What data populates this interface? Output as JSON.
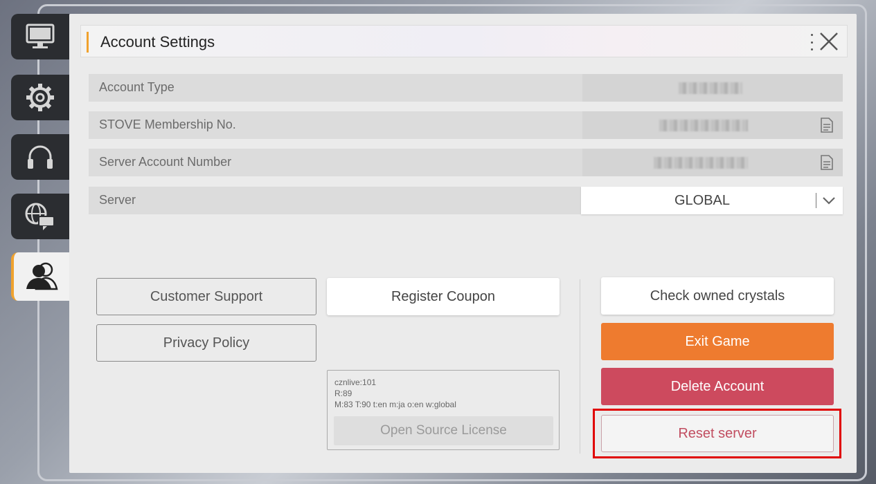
{
  "header": {
    "title": "Account Settings"
  },
  "sidebar": {
    "items": [
      {
        "name": "display",
        "icon": "monitor-icon"
      },
      {
        "name": "settings",
        "icon": "gear-icon"
      },
      {
        "name": "audio",
        "icon": "headphones-icon"
      },
      {
        "name": "language",
        "icon": "globe-chat-icon"
      },
      {
        "name": "account",
        "icon": "user-icon",
        "active": true
      }
    ]
  },
  "fields": {
    "account_type": {
      "label": "Account Type"
    },
    "stove_membership": {
      "label": "STOVE Membership No."
    },
    "server_account": {
      "label": "Server Account Number"
    },
    "server": {
      "label": "Server",
      "value": "GLOBAL"
    }
  },
  "buttons": {
    "customer_support": "Customer Support",
    "privacy_policy": "Privacy Policy",
    "register_coupon": "Register Coupon",
    "check_crystals": "Check owned crystals",
    "exit_game": "Exit Game",
    "delete_account": "Delete Account",
    "reset_server": "Reset server",
    "open_source_license": "Open Source License"
  },
  "version_info": {
    "line1": "cznlive:101",
    "line2": "R:89",
    "line3": "M:83 T:90 t:en m:ja o:en w:global"
  },
  "colors": {
    "accent": "#f0a22e",
    "exit": "#ee7b2f",
    "delete": "#cd4a5e",
    "highlight": "#e00000"
  }
}
